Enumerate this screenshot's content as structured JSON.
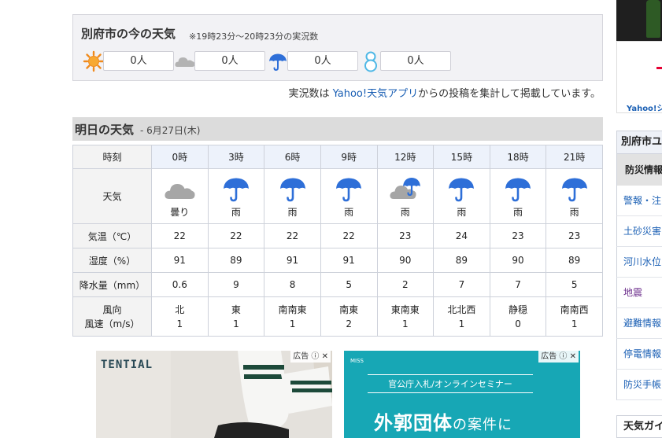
{
  "current": {
    "title": "別府市の今の天気",
    "note": "※19時23分～20時23分の実況数",
    "reports": [
      {
        "icon": "sun-icon",
        "count": "0人"
      },
      {
        "icon": "cloud-icon",
        "count": "0人"
      },
      {
        "icon": "umbrella-icon",
        "count": "0人"
      },
      {
        "icon": "snowman-icon",
        "count": "0人"
      }
    ],
    "footer_prefix": "実況数は ",
    "footer_link": "Yahoo!天気アプリ",
    "footer_suffix": "からの投稿を集計して掲載しています。"
  },
  "tomorrow": {
    "title": "明日の天気",
    "date": " - 6月27日(木)",
    "row_labels": {
      "hour": "時刻",
      "weather": "天気",
      "temp": "気温（℃）",
      "humidity": "湿度（%）",
      "precip": "降水量（mm）",
      "wind_dir": "風向",
      "wind_speed": "風速（m/s）"
    },
    "hours": [
      "0時",
      "3時",
      "6時",
      "9時",
      "12時",
      "15時",
      "18時",
      "21時"
    ],
    "weather": [
      {
        "icon": "cloud-icon",
        "label": "曇り"
      },
      {
        "icon": "umbrella-icon",
        "label": "雨"
      },
      {
        "icon": "umbrella-icon",
        "label": "雨"
      },
      {
        "icon": "umbrella-icon",
        "label": "雨"
      },
      {
        "icon": "cloud-umbrella-icon",
        "label": "雨"
      },
      {
        "icon": "umbrella-icon",
        "label": "雨"
      },
      {
        "icon": "umbrella-icon",
        "label": "雨"
      },
      {
        "icon": "umbrella-icon",
        "label": "雨"
      }
    ],
    "temp": [
      "22",
      "22",
      "22",
      "22",
      "23",
      "24",
      "23",
      "23"
    ],
    "humidity": [
      "91",
      "89",
      "91",
      "91",
      "90",
      "89",
      "90",
      "89"
    ],
    "precip": [
      "0.6",
      "9",
      "8",
      "5",
      "2",
      "7",
      "7",
      "5"
    ],
    "wind_dir": [
      "北",
      "東",
      "南南東",
      "南東",
      "東南東",
      "北北西",
      "静穏",
      "南南西"
    ],
    "wind_speed": [
      "1",
      "1",
      "1",
      "2",
      "1",
      "1",
      "0",
      "1"
    ]
  },
  "ads": {
    "tag": "広告",
    "ad1_brand": "TENTIAL",
    "ad2_brand": "MISS",
    "ad2_seminar": "官公庁入札/オンラインセミナー",
    "ad2_headline": "外郭団体",
    "ad2_headline_suffix": "の案件に"
  },
  "sidebar": {
    "yahoo_label": "Yahoo!シ",
    "city_header": "別府市ユ",
    "disaster_header": "防災情報",
    "items": [
      "警報・注",
      "土砂災害",
      "河川水位",
      "地震",
      "避難情報",
      "停電情報",
      "防災手帳"
    ],
    "guide": "天気ガイ"
  },
  "colors": {
    "umbrella": "#2e6fd8",
    "sun": "#f08a1c",
    "cloud": "#9a9a9a",
    "link": "#1a5fb4"
  }
}
